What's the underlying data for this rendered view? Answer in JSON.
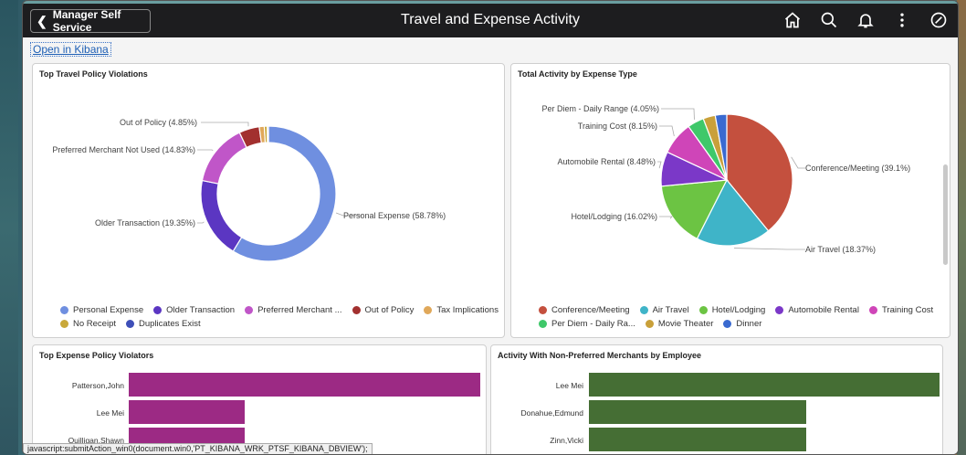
{
  "header": {
    "back_label": "Manager Self Service",
    "title": "Travel and Expense Activity"
  },
  "kibana_link": "Open in Kibana",
  "panels": {
    "violations": {
      "title": "Top Travel Policy Violations",
      "legend": [
        {
          "label": "Personal Expense",
          "color": "#6f8fe0"
        },
        {
          "label": "Older Transaction",
          "color": "#5b36c2"
        },
        {
          "label": "Preferred Merchant ...",
          "color": "#c056c8"
        },
        {
          "label": "Out of Policy",
          "color": "#a2302f"
        },
        {
          "label": "Tax Implications",
          "color": "#e0a85a"
        },
        {
          "label": "No Receipt",
          "color": "#c9a83a"
        },
        {
          "label": "Duplicates Exist",
          "color": "#3e4fb8"
        }
      ]
    },
    "expense_type": {
      "title": "Total Activity by Expense Type",
      "legend": [
        {
          "label": "Conference/Meeting",
          "color": "#c4503e"
        },
        {
          "label": "Air Travel",
          "color": "#3fb4c8"
        },
        {
          "label": "Hotel/Lodging",
          "color": "#6cc443"
        },
        {
          "label": "Automobile Rental",
          "color": "#7b38c8"
        },
        {
          "label": "Training Cost",
          "color": "#cf45b8"
        },
        {
          "label": "Per Diem - Daily Ra...",
          "color": "#3fc86a"
        },
        {
          "label": "Movie Theater",
          "color": "#c9a03a"
        },
        {
          "label": "Dinner",
          "color": "#3a6ad0"
        }
      ]
    },
    "violators": {
      "title": "Top Expense Policy Violators"
    },
    "non_preferred": {
      "title": "Activity With Non-Preferred Merchants by Employee"
    }
  },
  "status_text": "javascript:submitAction_win0(document.win0,'PT_KIBANA_WRK_PTSF_KIBANA_DBVIEW');",
  "chart_data": [
    {
      "type": "pie",
      "title": "Top Travel Policy Violations",
      "donut": true,
      "slices": [
        {
          "label": "Personal Expense",
          "value": 58.78,
          "color": "#6f8fe0",
          "text": "Personal Expense (58.78%)"
        },
        {
          "label": "Older Transaction",
          "value": 19.35,
          "color": "#5b36c2",
          "text": "Older Transaction (19.35%)"
        },
        {
          "label": "Preferred Merchant Not Used",
          "value": 14.83,
          "color": "#c056c8",
          "text": "Preferred Merchant Not Used (14.83%)"
        },
        {
          "label": "Out of Policy",
          "value": 4.85,
          "color": "#a2302f",
          "text": "Out of Policy (4.85%)"
        },
        {
          "label": "Tax Implications",
          "value": 1.2,
          "color": "#e0a85a",
          "text": ""
        },
        {
          "label": "No Receipt",
          "value": 0.7,
          "color": "#c9a83a",
          "text": ""
        },
        {
          "label": "Duplicates Exist",
          "value": 0.29,
          "color": "#3e4fb8",
          "text": ""
        }
      ]
    },
    {
      "type": "pie",
      "title": "Total Activity by Expense Type",
      "donut": false,
      "slices": [
        {
          "label": "Conference/Meeting",
          "value": 39.1,
          "color": "#c4503e",
          "text": "Conference/Meeting (39.1%)"
        },
        {
          "label": "Air Travel",
          "value": 18.37,
          "color": "#3fb4c8",
          "text": "Air Travel (18.37%)"
        },
        {
          "label": "Hotel/Lodging",
          "value": 16.02,
          "color": "#6cc443",
          "text": "Hotel/Lodging (16.02%)"
        },
        {
          "label": "Automobile Rental",
          "value": 8.48,
          "color": "#7b38c8",
          "text": "Automobile Rental (8.48%)"
        },
        {
          "label": "Training Cost",
          "value": 8.15,
          "color": "#cf45b8",
          "text": "Training Cost (8.15%)"
        },
        {
          "label": "Per Diem - Daily Range",
          "value": 4.05,
          "color": "#3fc86a",
          "text": "Per Diem - Daily Range (4.05%)"
        },
        {
          "label": "Movie Theater",
          "value": 3.0,
          "color": "#c9a03a",
          "text": ""
        },
        {
          "label": "Dinner",
          "value": 2.83,
          "color": "#3a6ad0",
          "text": ""
        }
      ]
    },
    {
      "type": "bar",
      "orientation": "horizontal",
      "title": "Top Expense Policy Violators",
      "color": "#9c2a84",
      "categories": [
        "Patterson,John",
        "Lee Mei",
        "Quilligan,Shawn"
      ],
      "values": [
        100,
        33,
        33
      ]
    },
    {
      "type": "bar",
      "orientation": "horizontal",
      "title": "Activity With Non-Preferred Merchants by Employee",
      "color": "#456e34",
      "categories": [
        "Lee Mei",
        "Donahue,Edmund",
        "Zinn,Vicki"
      ],
      "values": [
        100,
        62,
        62
      ]
    }
  ]
}
